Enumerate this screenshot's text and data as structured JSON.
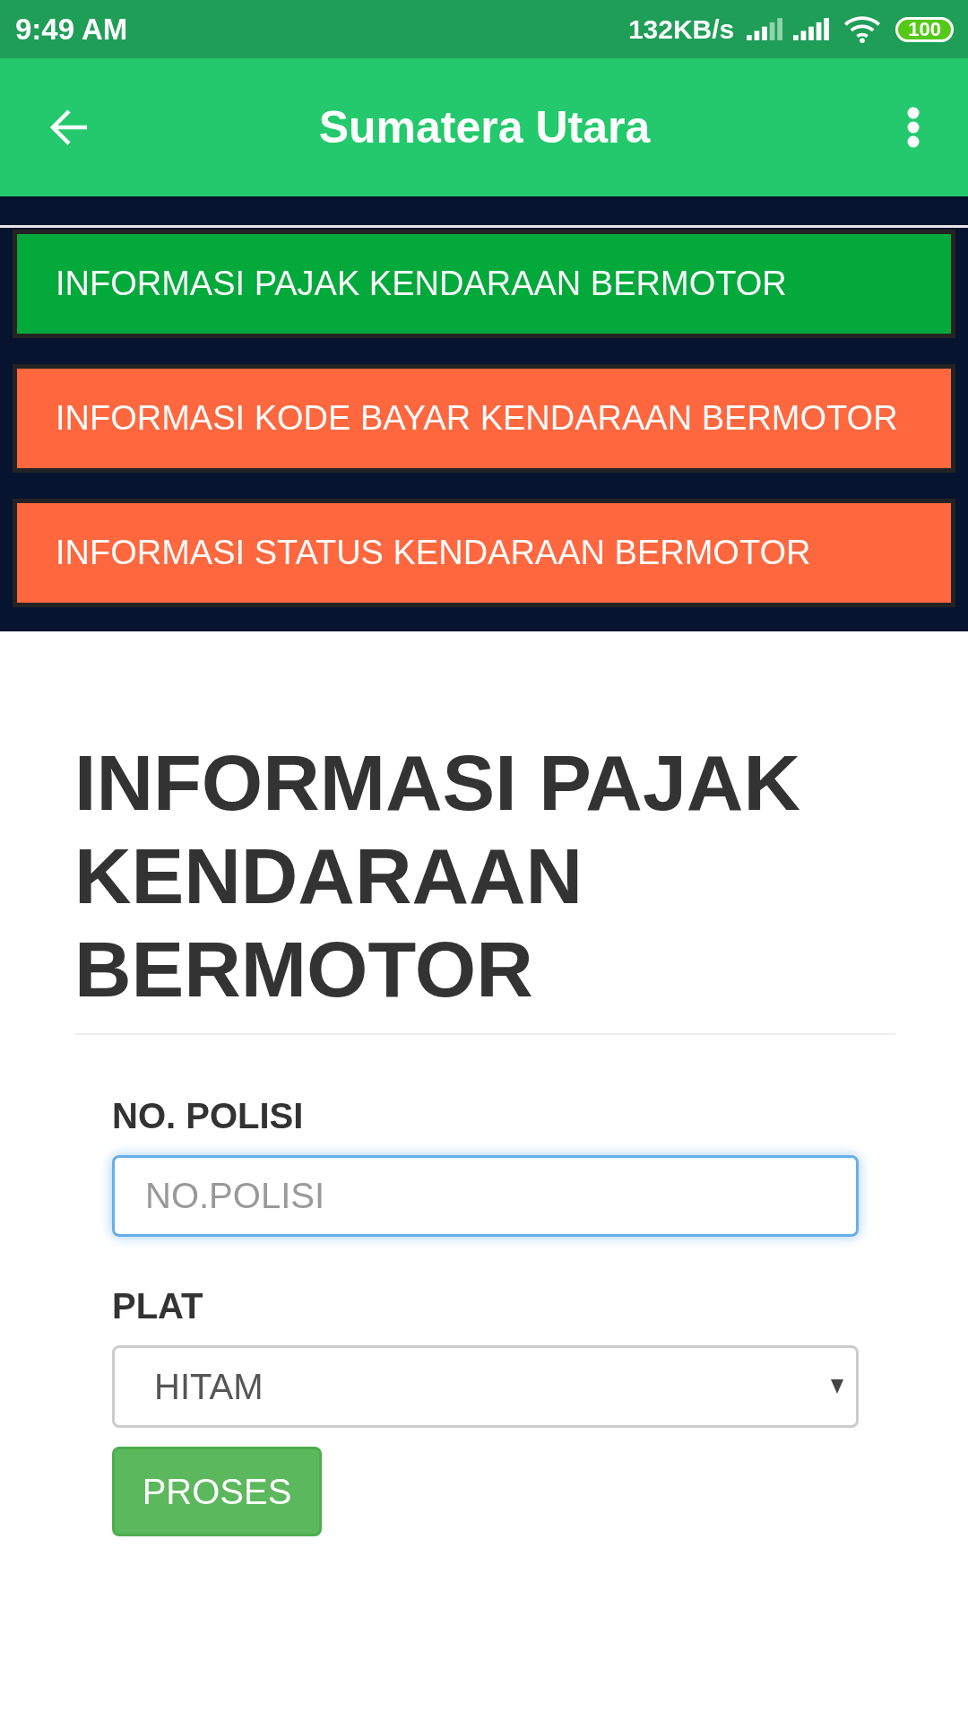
{
  "status_bar": {
    "time": "9:49 AM",
    "net_speed": "132KB/s",
    "battery": "100"
  },
  "app_bar": {
    "title": "Sumatera Utara"
  },
  "menu": [
    {
      "label": "INFORMASI PAJAK KENDARAAN BERMOTOR",
      "selected": true
    },
    {
      "label": "INFORMASI KODE BAYAR KENDARAAN BERMOTOR",
      "selected": false
    },
    {
      "label": "INFORMASI STATUS KENDARAAN BERMOTOR",
      "selected": false
    }
  ],
  "form": {
    "heading": "INFORMASI PAJAK KENDARAAN BERMOTOR",
    "fields": [
      {
        "kind": "text",
        "label": "NO. POLISI",
        "placeholder": "NO.POLISI",
        "focused": true
      },
      {
        "kind": "select",
        "label": "PLAT",
        "value": "HITAM",
        "focused": false
      }
    ],
    "submit": "PROSES"
  }
}
